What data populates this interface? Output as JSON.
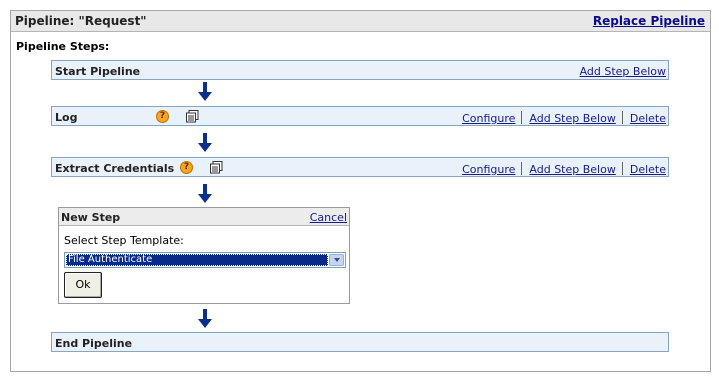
{
  "panel": {
    "title": "Pipeline: \"Request\"",
    "replace_link": "Replace Pipeline"
  },
  "steps_title": "Pipeline Steps:",
  "steps": {
    "start": {
      "label": "Start Pipeline",
      "action": "Add Step Below"
    },
    "log": {
      "label": "Log",
      "configure": "Configure",
      "add": "Add Step Below",
      "delete": "Delete"
    },
    "extract": {
      "label": "Extract Credentials",
      "configure": "Configure",
      "add": "Add Step Below",
      "delete": "Delete"
    },
    "end": {
      "label": "End Pipeline"
    }
  },
  "new_step": {
    "title": "New Step",
    "cancel": "Cancel",
    "template_label": "Select Step Template:",
    "selected_template": "File Authenticate",
    "ok": "Ok"
  },
  "icons": {
    "help": "help-icon",
    "properties": "properties-icon",
    "arrow": "down-arrow-icon"
  },
  "colors": {
    "step_bar": "#e9f1fa",
    "arrow": "#0b2f8f",
    "link": "#1a1a8a"
  }
}
